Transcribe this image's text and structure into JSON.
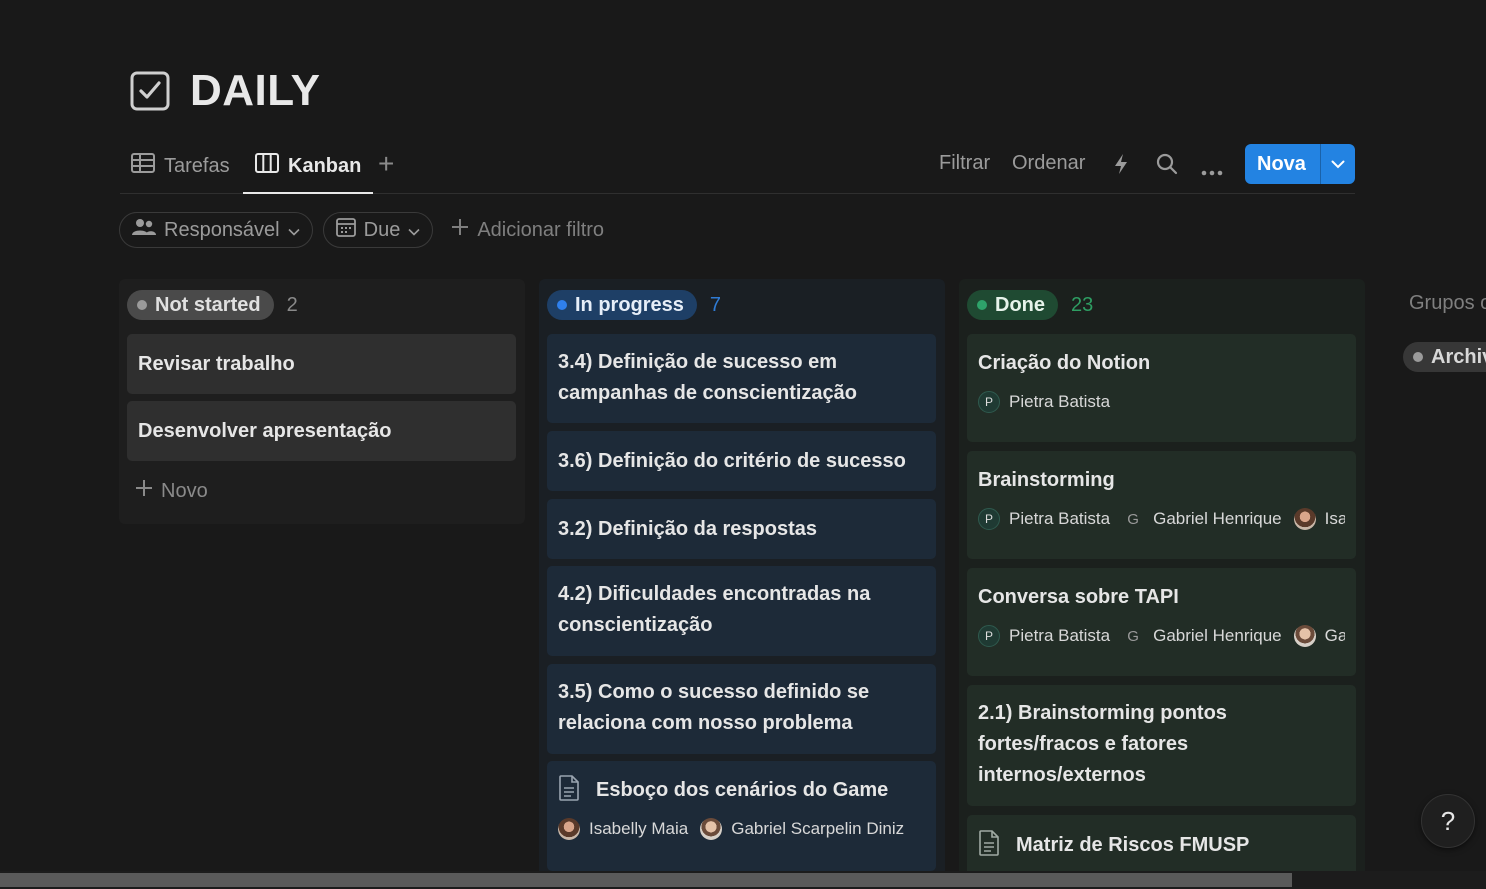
{
  "page": {
    "title": "DAILY",
    "icon": "checkbox-icon"
  },
  "views": {
    "tabs": [
      {
        "label": "Tarefas",
        "icon": "table-icon",
        "active": false
      },
      {
        "label": "Kanban",
        "icon": "board-icon",
        "active": true
      }
    ],
    "add_label": "+"
  },
  "toolbar": {
    "filter_label": "Filtrar",
    "sort_label": "Ordenar",
    "new_label": "Nova"
  },
  "filters": {
    "chips": [
      {
        "label": "Responsável",
        "icon": "people-icon"
      },
      {
        "label": "Due",
        "icon": "calendar-icon"
      }
    ],
    "add_filter_label": "Adicionar filtro"
  },
  "columns": [
    {
      "status": "Not started",
      "count": "2",
      "dot_color": "#9b9b9b",
      "pill_bg": "#4a4a4a",
      "card_bg": "#2f2f2f",
      "cards": [
        {
          "title": "Revisar trabalho"
        },
        {
          "title": "Desenvolver apresentação"
        }
      ],
      "new_label": "Novo"
    },
    {
      "status": "In progress",
      "count": "7",
      "dot_color": "#2f80ed",
      "pill_bg": "#1e3f66",
      "card_bg": "#1d2a38",
      "cards": [
        {
          "title": "3.4) Definição de sucesso em campanhas de conscientização"
        },
        {
          "title": "3.6) Definição do critério de sucesso"
        },
        {
          "title": "3.2) Definição da respostas"
        },
        {
          "title": "4.2) Dificuldades encontradas na conscientização"
        },
        {
          "title": "3.5) Como o sucesso definido se relaciona com nosso problema"
        },
        {
          "title": "Esboço dos cenários do Game",
          "people": [
            "Isabelly Maia",
            "Gabriel Scarpelin Diniz"
          ]
        }
      ]
    },
    {
      "status": "Done",
      "count": "23",
      "dot_color": "#2ea36a",
      "pill_bg": "#1f4a32",
      "card_bg": "#222d26",
      "cards": [
        {
          "title": "Criação do Notion",
          "people": [
            "Pietra Batista"
          ]
        },
        {
          "title": "Brainstorming",
          "people": [
            "Pietra Batista",
            "Gabriel Henrique",
            "Isa"
          ]
        },
        {
          "title": "Conversa sobre TAPI",
          "people": [
            "Pietra Batista",
            "Gabriel Henrique",
            "Ga"
          ]
        },
        {
          "title": "2.1) Brainstorming pontos fortes/fracos e fatores internos/externos"
        },
        {
          "title": "Matriz de Riscos FMUSP"
        }
      ]
    }
  ],
  "hidden_groups": {
    "label": "Grupos o",
    "archived_label": "Archiv"
  },
  "help_label": "?"
}
